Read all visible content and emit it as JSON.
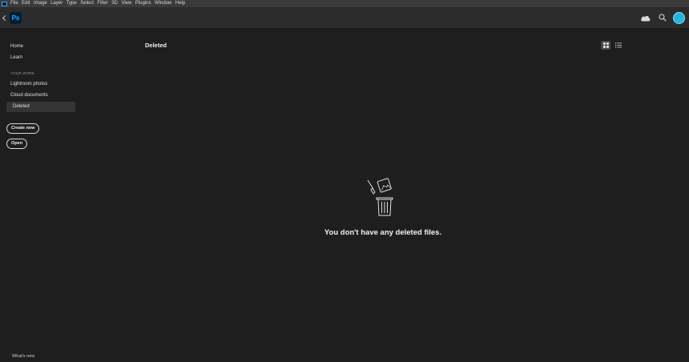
{
  "menubar": {
    "items": [
      "File",
      "Edit",
      "Image",
      "Layer",
      "Type",
      "Select",
      "Filter",
      "3D",
      "View",
      "Plugins",
      "Window",
      "Help"
    ]
  },
  "header": {
    "logo_text": "Ps"
  },
  "sidebar": {
    "items_top": [
      {
        "label": "Home"
      },
      {
        "label": "Learn"
      }
    ],
    "section_label": "YOUR WORK",
    "items_work": [
      {
        "label": "Lightroom photos"
      },
      {
        "label": "Cloud documents"
      },
      {
        "label": "Deleted",
        "active": true
      }
    ],
    "create_new_label": "Create new",
    "open_label": "Open",
    "whats_new_label": "What's new"
  },
  "main": {
    "title": "Deleted",
    "empty_message": "You don't have any deleted files."
  },
  "colors": {
    "accent": "#31a8ff",
    "avatar": "#22b5e0",
    "background": "#1e1e1e"
  }
}
